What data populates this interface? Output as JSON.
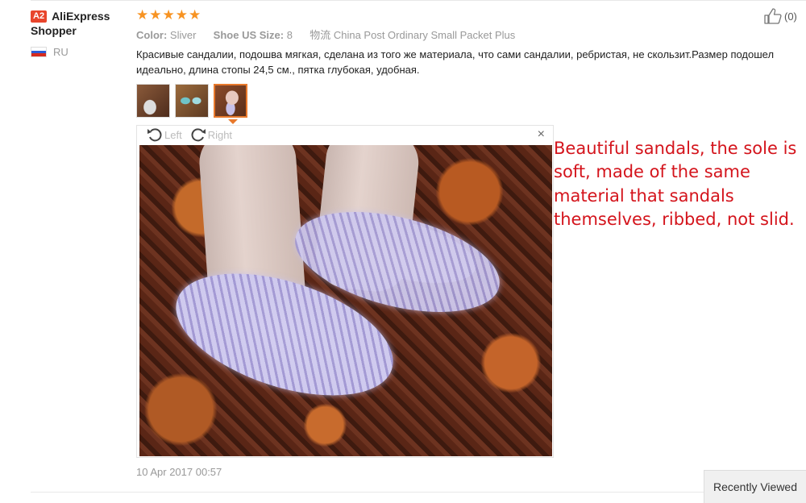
{
  "user": {
    "level": "A2",
    "name": "AliExpress Shopper",
    "country_code": "RU",
    "flag_colors": [
      "#ffffff",
      "#2a5bd7",
      "#d52b1e"
    ]
  },
  "rating": {
    "stars": 5,
    "max": 5,
    "color": "#f79322"
  },
  "helpful": {
    "count_label": "(0)",
    "icon": "thumbs-up-icon"
  },
  "meta": {
    "color_label": "Color:",
    "color_value": "Sliver",
    "size_label": "Shoe US Size:",
    "size_value": "8",
    "shipping_label": "物流",
    "shipping_value": "China Post Ordinary Small Packet Plus"
  },
  "review_text": "Красивые сандалии, подошва мягкая, сделана из того же материала, что сами сандалии, ребристая, не скользит.Размер подошел идеально, длина стопы 24,5 см., пятка глубокая, удобная.",
  "thumbnails": [
    {
      "alt": "review photo 1",
      "active": false
    },
    {
      "alt": "review photo 2",
      "active": false
    },
    {
      "alt": "review photo 3",
      "active": true
    }
  ],
  "viewer": {
    "rotate_left_label": "Left",
    "rotate_right_label": "Right",
    "close_label": "×"
  },
  "annotation_text": "Beautiful sandals, the sole is soft, made of the same material that sandals themselves, ribbed, not slid.",
  "date": "10 Apr 2017 00:57",
  "recently_viewed_label": "Recently Viewed",
  "accent_color": "#e8792c",
  "annotation_color": "#d4141c"
}
